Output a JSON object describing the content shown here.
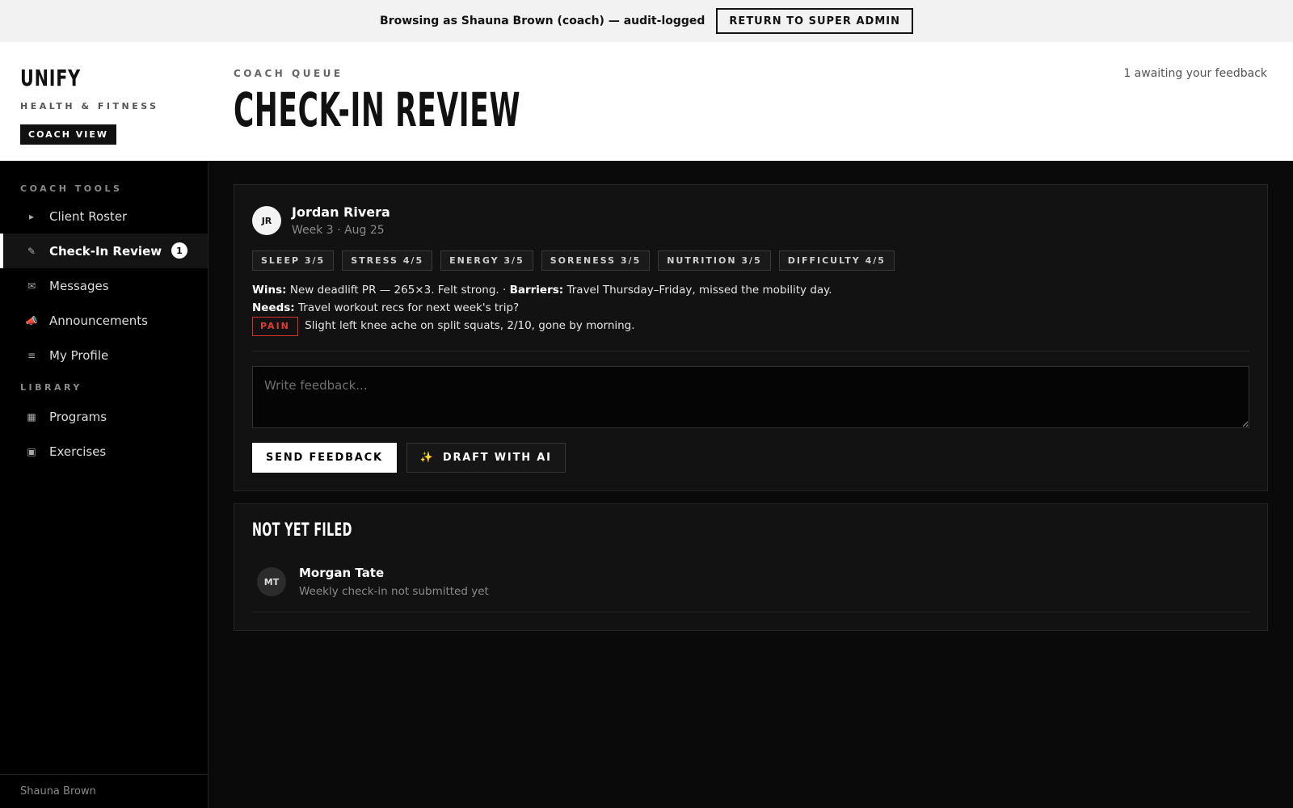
{
  "banner": {
    "text": "Browsing as Shauna Brown (coach) — audit-logged",
    "button_label": "RETURN TO SUPER ADMIN"
  },
  "brand": {
    "name": "UNIFY",
    "subtitle": "HEALTH & FITNESS",
    "view_badge": "COACH VIEW"
  },
  "header": {
    "eyebrow": "COACH QUEUE",
    "title": "CHECK-IN REVIEW",
    "awaiting": "1 awaiting your feedback"
  },
  "sidebar": {
    "sections": [
      {
        "title": "COACH TOOLS",
        "items": [
          {
            "label": "Client Roster",
            "icon": "caret-right-icon",
            "glyph": "▸"
          },
          {
            "label": "Check-In Review",
            "icon": "pencil-icon",
            "glyph": "✎",
            "active": true,
            "badge": "1"
          },
          {
            "label": "Messages",
            "icon": "envelope-icon",
            "glyph": "✉"
          },
          {
            "label": "Announcements",
            "icon": "megaphone-icon",
            "glyph": "📣"
          },
          {
            "label": "My Profile",
            "icon": "menu-lines-icon",
            "glyph": "≡"
          }
        ]
      },
      {
        "title": "LIBRARY",
        "items": [
          {
            "label": "Programs",
            "icon": "grid-icon",
            "glyph": "▦"
          },
          {
            "label": "Exercises",
            "icon": "square-icon",
            "glyph": "▣"
          }
        ]
      }
    ],
    "footer_user": "Shauna Brown"
  },
  "checkin": {
    "avatar_initials": "JR",
    "client_name": "Jordan Rivera",
    "meta": "Week 3 · Aug 25",
    "tags": [
      "SLEEP 3/5",
      "STRESS 4/5",
      "ENERGY 3/5",
      "SORENESS 3/5",
      "NUTRITION 3/5",
      "DIFFICULTY 4/5"
    ],
    "wins_label": "Wins:",
    "wins_text": "New deadlift PR — 265×3. Felt strong. ·",
    "barriers_label": "Barriers:",
    "barriers_text": "Travel Thursday–Friday, missed the mobility day.",
    "needs_label": "Needs:",
    "needs_text": "Travel workout recs for next week's trip?",
    "pain_label": "PAIN",
    "pain_text": "Slight left knee ache on split squats, 2/10, gone by morning.",
    "feedback_placeholder": "Write feedback...",
    "send_label": "SEND FEEDBACK",
    "draft_label": "DRAFT WITH AI"
  },
  "not_filed": {
    "title": "NOT YET FILED",
    "items": [
      {
        "initials": "MT",
        "name": "Morgan Tate",
        "meta": "Weekly check-in not submitted yet"
      }
    ]
  },
  "colors": {
    "pain": "#e03a36",
    "ai_spark": "#f5c518"
  }
}
